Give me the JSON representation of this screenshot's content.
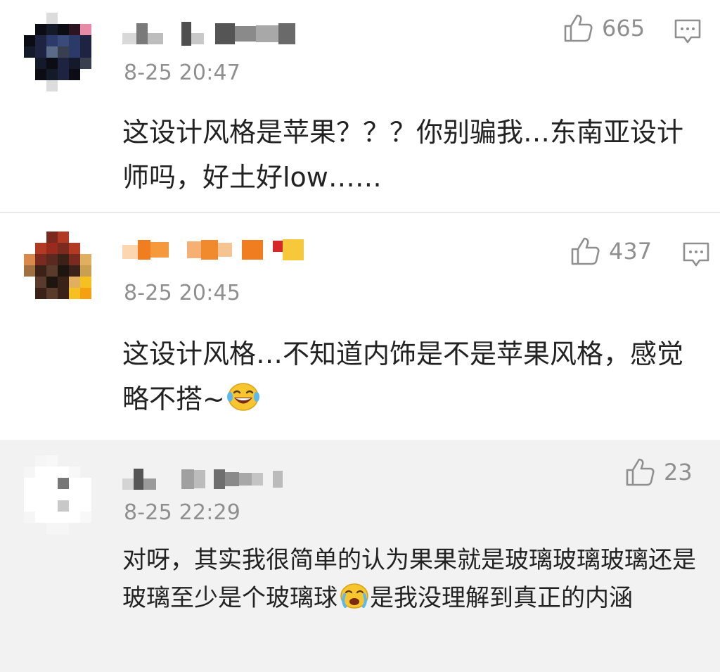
{
  "comments": [
    {
      "time": "8-25 20:47",
      "like_count": "665",
      "text": "这设计风格是苹果？？？你别骗我…东南亚设计师吗，好土好low……",
      "avatar_palette": [
        "#0b0c14",
        "#1d2340",
        "#2c3a6a",
        "#5a6b8a",
        "#e68aa8",
        "#3a3f4f",
        "#141a2a"
      ]
    },
    {
      "time": "8-25 20:45",
      "like_count": "437",
      "text": "这设计风格…不知道内饰是不是苹果风格，感觉略不搭~",
      "emoji": "laugh-cry",
      "avatar_palette": [
        "#7a2a1e",
        "#b33a22",
        "#3a2218",
        "#e0b060",
        "#f5c020",
        "#5a3a2a",
        "#d98a4a"
      ]
    },
    {
      "time": "8-25 22:29",
      "like_count": "23",
      "text_a": "对呀，其实我很简单的认为果果就是玻璃玻璃玻璃还是玻璃至少是个玻璃球",
      "emoji": "crying",
      "text_b": "是我没理解到真正的内涵",
      "avatar_palette": [
        "#ffffff",
        "#eeeeee",
        "#c8c8c8",
        "#777777",
        "#aaaaaa"
      ]
    }
  ],
  "colors": {
    "meta_gray": "#8f8f8f",
    "text": "#222222",
    "divider": "#e9e9e9",
    "reply_bg": "#f2f2f2"
  },
  "icons": [
    "thumbs-up-icon",
    "comment-reply-icon"
  ]
}
